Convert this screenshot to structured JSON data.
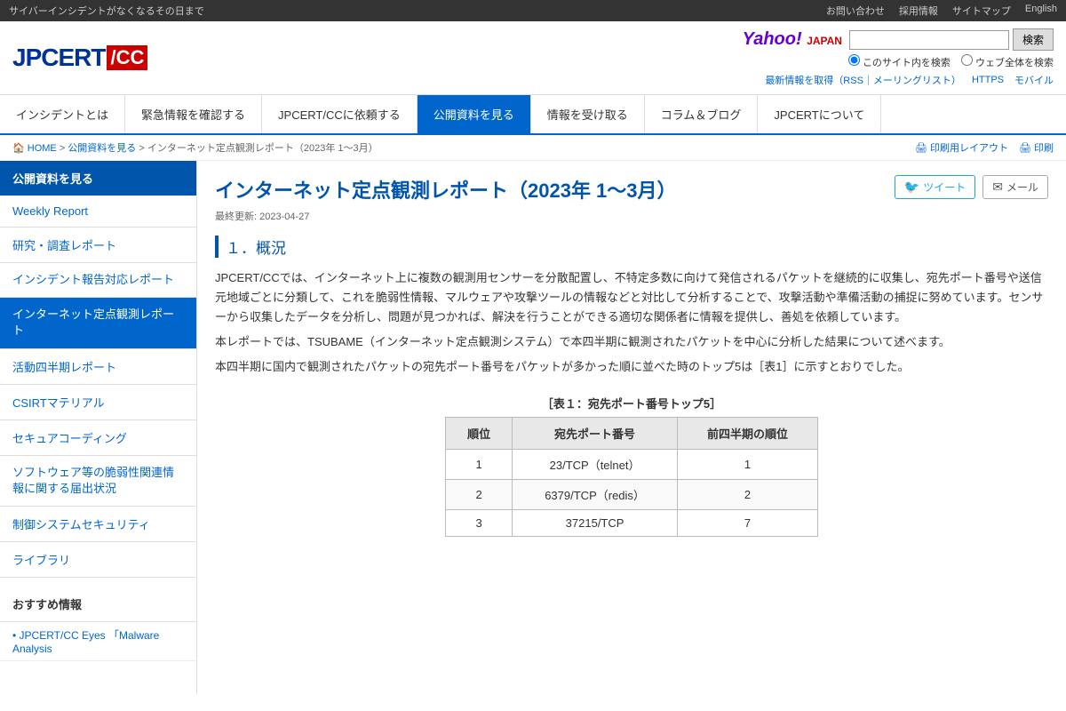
{
  "topbar": {
    "tagline": "サイバーインシデントがなくなるその日まで",
    "links": [
      {
        "label": "お問い合わせ",
        "name": "contact-link"
      },
      {
        "label": "採用情報",
        "name": "recruitment-link"
      },
      {
        "label": "サイトマップ",
        "name": "sitemap-link"
      },
      {
        "label": "English",
        "name": "english-link"
      }
    ]
  },
  "header": {
    "logo_text": "JPCERT",
    "logo_cc": "CC",
    "yahoo_logo": "Yahoo!",
    "yahoo_logo_japan": "JAPAN",
    "search_placeholder": "",
    "search_button_label": "検索",
    "radio_site": "このサイト内を検索",
    "radio_web": "ウェブ全体を検索",
    "meta_links": [
      {
        "label": "最新情報を取得（RSS｜メーリングリスト）"
      },
      {
        "label": "HTTPS"
      },
      {
        "label": "モバイル"
      }
    ]
  },
  "nav": {
    "items": [
      {
        "label": "インシデントとは",
        "active": false
      },
      {
        "label": "緊急情報を確認する",
        "active": false
      },
      {
        "label": "JPCERT/CCに依頼する",
        "active": false
      },
      {
        "label": "公開資料を見る",
        "active": true
      },
      {
        "label": "情報を受け取る",
        "active": false
      },
      {
        "label": "コラム＆ブログ",
        "active": false
      },
      {
        "label": "JPCERTについて",
        "active": false
      }
    ]
  },
  "breadcrumb": {
    "items": [
      {
        "label": "HOME"
      },
      {
        "label": "公開資料を見る"
      },
      {
        "label": "インターネット定点観測レポート（2023年 1〜3月）"
      }
    ],
    "print_label": "印刷用レイアウト",
    "print_icon": "🖨",
    "other_label": "印刷"
  },
  "sidebar": {
    "section_title": "公開資料を見る",
    "items": [
      {
        "label": "Weekly Report",
        "active": false,
        "name": "sidebar-weekly-report"
      },
      {
        "label": "研究・調査レポート",
        "active": false,
        "name": "sidebar-research"
      },
      {
        "label": "インシデント報告対応レポート",
        "active": false,
        "name": "sidebar-incident"
      },
      {
        "label": "インターネット定点観測レポート",
        "active": true,
        "name": "sidebar-internet"
      },
      {
        "label": "活動四半期レポート",
        "active": false,
        "name": "sidebar-quarterly"
      },
      {
        "label": "CSIRTマテリアル",
        "active": false,
        "name": "sidebar-csirt"
      },
      {
        "label": "セキュアコーディング",
        "active": false,
        "name": "sidebar-secure-coding"
      },
      {
        "label": "ソフトウェア等の脆弱性関連情報に関する届出状況",
        "active": false,
        "name": "sidebar-vuln"
      },
      {
        "label": "制御システムセキュリティ",
        "active": false,
        "name": "sidebar-control"
      },
      {
        "label": "ライブラリ",
        "active": false,
        "name": "sidebar-library"
      }
    ],
    "recommend_title": "おすすめ情報",
    "recommend_items": [
      {
        "label": "• JPCERT/CC Eyes 「Malware Analysis"
      },
      {
        "label": ""
      }
    ]
  },
  "main": {
    "page_title": "インターネット定点観測レポート（2023年 1〜3月）",
    "last_updated_label": "最終更新:",
    "last_updated_date": "2023-04-27",
    "share": {
      "tweet_label": "ツイート",
      "mail_label": "メール"
    },
    "section1_title": "１．概況",
    "body1": "JPCERT/CCでは、インターネット上に複数の観測用センサーを分散配置し、不特定多数に向けて発信されるパケットを継続的に収集し、宛先ポート番号や送信元地域ごとに分類して、これを脆弱性情報、マルウェアや攻撃ツールの情報などと対比して分析することで、攻撃活動や準備活動の捕捉に努めています。センサーから収集したデータを分析し、問題が見つかれば、解決を行うことができる適切な関係者に情報を提供し、善処を依頼しています。",
    "body2": "本レポートでは、TSUBAME（インターネット定点観測システム）で本四半期に観測されたパケットを中心に分析した結果について述べます。",
    "body3": "本四半期に国内で観測されたパケットの宛先ポート番号をパケットが多かった順に並べた時のトップ5は［表1］に示すとおりでした。",
    "table": {
      "caption": "［表１：宛先ポート番号トップ5］",
      "headers": [
        "順位",
        "宛先ポート番号",
        "前四半期の順位"
      ],
      "rows": [
        {
          "rank": "1",
          "port": "23/TCP（telnet）",
          "prev": "1"
        },
        {
          "rank": "2",
          "port": "6379/TCP（redis）",
          "prev": "2"
        },
        {
          "rank": "3",
          "port": "37215/TCP",
          "prev": "7"
        }
      ]
    }
  }
}
